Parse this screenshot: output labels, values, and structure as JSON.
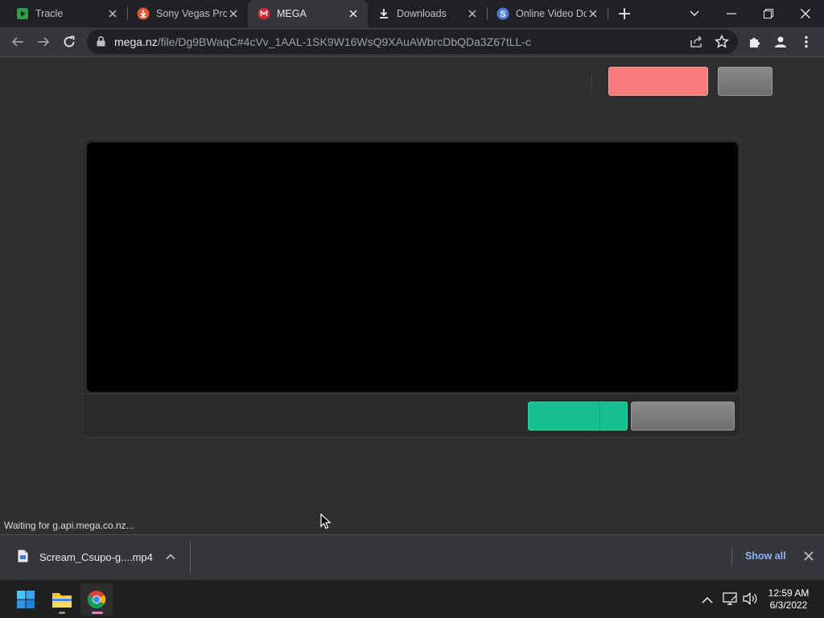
{
  "browser": {
    "tabs": [
      {
        "title": "Tracle",
        "favicon": "play-icon",
        "active": false
      },
      {
        "title": "Sony Vegas Pro",
        "favicon": "download-circle-icon",
        "active": false
      },
      {
        "title": "MEGA",
        "favicon": "mega-logo-icon",
        "active": true
      },
      {
        "title": "Downloads",
        "favicon": "download-icon",
        "active": false
      },
      {
        "title": "Online Video Do",
        "favicon": "s-circle-icon",
        "active": false
      }
    ],
    "url_host": "mega.nz",
    "url_path": "/file/Dg9BWaqC#4cVv_1AAL-1SK9W16WsQ9XAuAWbrcDbQDa3Z67tLL-c",
    "status_text": "Waiting for g.api.mega.co.nz..."
  },
  "colors": {
    "mega_red": "#f77b7b",
    "download_green": "#16c08e",
    "link_blue": "#8ab4f8"
  },
  "download_shelf": {
    "file_name": "Scream_Csupo-g....mp4",
    "show_all_label": "Show all"
  },
  "taskbar": {
    "apps": [
      "start-icon",
      "file-explorer-icon",
      "chrome-icon"
    ],
    "time": "12:59 AM",
    "date": "6/3/2022"
  }
}
